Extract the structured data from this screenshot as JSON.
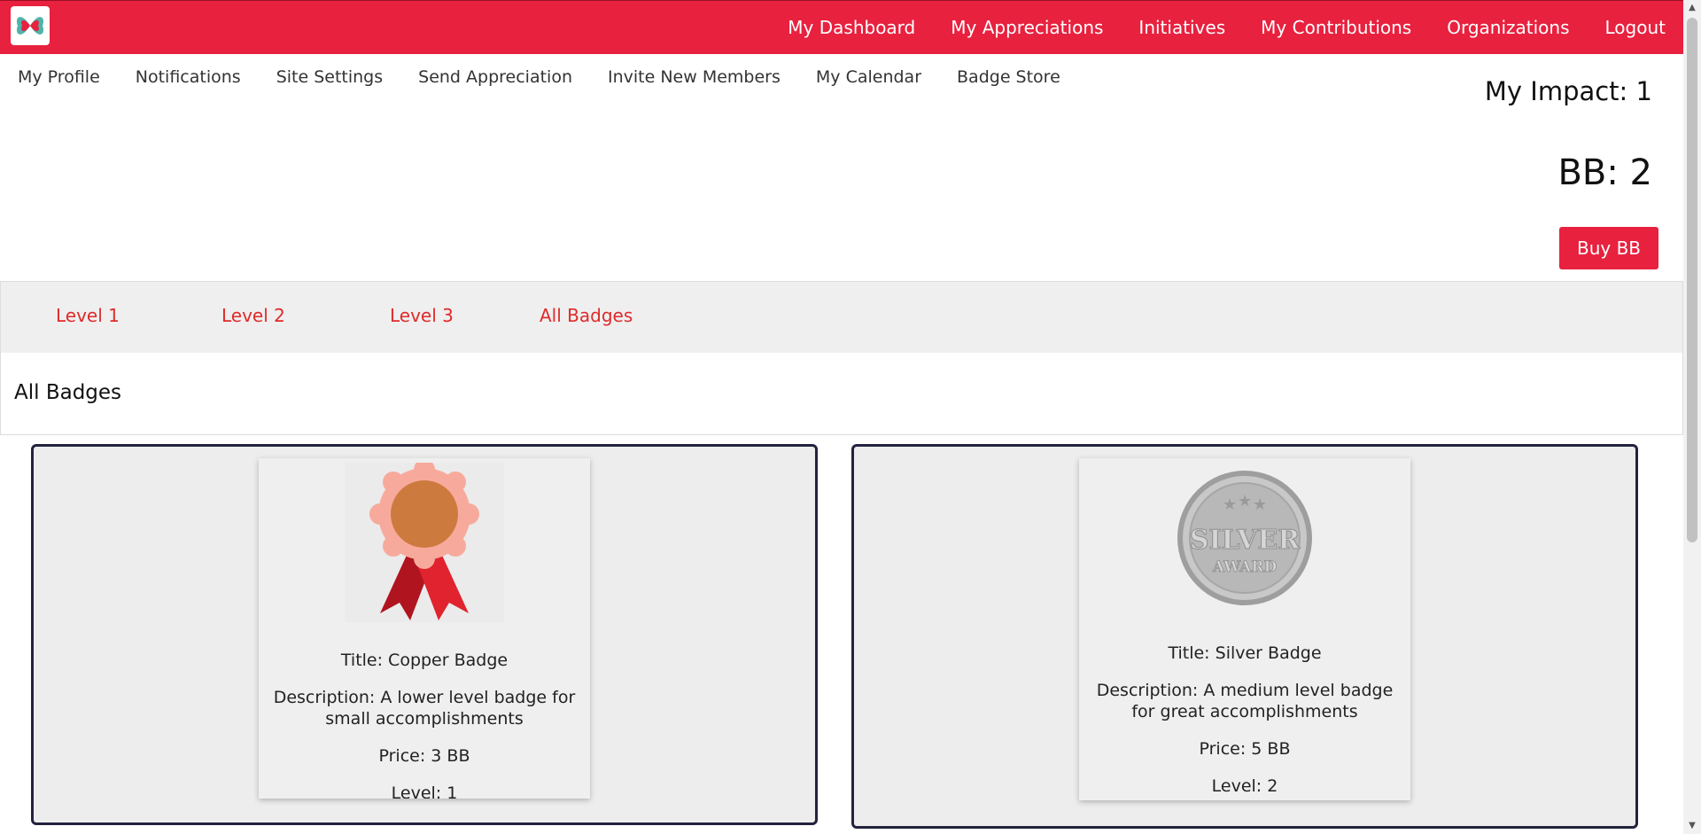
{
  "topnav": {
    "logo_icon": "butterfly-logo-icon",
    "links": [
      "My Dashboard",
      "My Appreciations",
      "Initiatives",
      "My Contributions",
      "Organizations",
      "Logout"
    ]
  },
  "subnav": {
    "links": [
      "My Profile",
      "Notifications",
      "Site Settings",
      "Send Appreciation",
      "Invite New Members",
      "My Calendar",
      "Badge Store"
    ]
  },
  "stats": {
    "impact": "My Impact: 1",
    "bb": "BB: 2",
    "buy_label": "Buy BB"
  },
  "levels": {
    "tabs": [
      "Level 1",
      "Level 2",
      "Level 3",
      "All Badges"
    ]
  },
  "section_title": "All Badges",
  "badges": [
    {
      "image": "copper-ribbon-medal-icon",
      "title": "Title: Copper Badge",
      "description": "Description: A lower level badge for small accomplishments",
      "price": "Price: 3 BB",
      "level": "Level: 1"
    },
    {
      "image": "silver-award-coin-icon",
      "image_text_top": "SILVER",
      "image_text_bottom": "AWARD",
      "title": "Title: Silver Badge",
      "description": "Description: A medium level badge for great accomplishments",
      "price": "Price: 5 BB",
      "level": "Level: 2"
    }
  ],
  "colors": {
    "brand_red": "#e8213f",
    "tab_text": "#e02a2a",
    "panel_border": "#23233f"
  }
}
